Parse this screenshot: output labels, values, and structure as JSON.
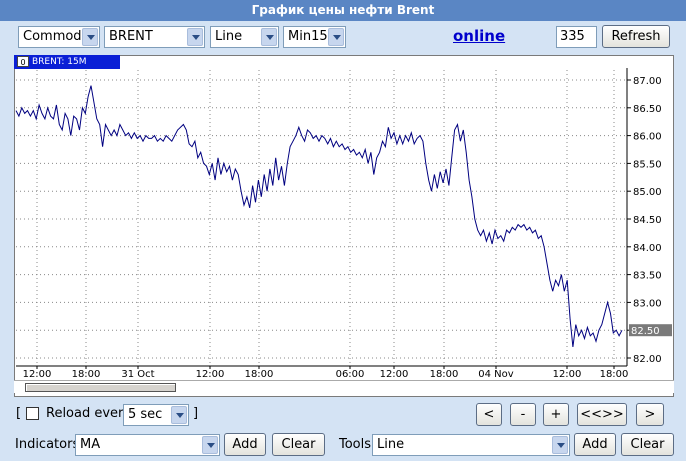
{
  "window": {
    "title": "График цены нефти Brent"
  },
  "toolbar": {
    "market_select": "Commod",
    "symbol_select": "BRENT",
    "type_select": "Line",
    "period_select": "Min15",
    "online_link": "online",
    "count_value": "335",
    "refresh_label": "Refresh"
  },
  "chart": {
    "tab_box": "0",
    "tab_label": "BRENT: 15M",
    "current_price_label": "82.50",
    "line_color": "#000080",
    "highlight_color": "#0a1fd6",
    "y_ticks": [
      "87.00",
      "86.50",
      "86.00",
      "85.50",
      "85.00",
      "84.50",
      "84.00",
      "83.50",
      "83.00",
      "82.50",
      "82.00"
    ],
    "x_ticks": [
      "12:00",
      "18:00",
      "31 Oct",
      "12:00",
      "18:00",
      "06:00",
      "12:00",
      "18:00",
      "04 Nov",
      "12:00",
      "18:00"
    ]
  },
  "chart_data": {
    "type": "line",
    "title": "",
    "xlabel": "",
    "ylabel": "",
    "ylim": [
      81.9,
      87.2
    ],
    "x_ticks": [
      "12:00",
      "18:00",
      "31 Oct",
      "12:00",
      "18:00",
      "06:00",
      "12:00",
      "18:00",
      "04 Nov",
      "12:00",
      "18:00"
    ],
    "y_ticks": [
      87.0,
      86.5,
      86.0,
      85.5,
      85.0,
      84.5,
      84.0,
      83.5,
      83.0,
      82.5,
      82.0
    ],
    "grid": true,
    "current_value": 82.5,
    "series": [
      {
        "values": [
          86.45,
          86.35,
          86.5,
          86.4,
          86.45,
          86.35,
          86.45,
          86.3,
          86.55,
          86.4,
          86.3,
          86.5,
          86.35,
          86.3,
          86.55,
          86.2,
          86.1,
          86.4,
          86.3,
          86.0,
          86.35,
          86.3,
          86.1,
          86.5,
          86.4,
          86.7,
          86.9,
          86.6,
          86.3,
          86.2,
          85.8,
          86.2,
          86.1,
          86.0,
          86.1,
          86.0,
          86.2,
          86.1,
          86.0,
          86.05,
          85.95,
          86.05,
          85.95,
          86.0,
          85.9,
          86.0,
          85.95,
          85.95,
          86.0,
          85.9,
          85.95,
          85.9,
          86.0,
          85.95,
          85.9,
          86.0,
          86.1,
          86.15,
          86.2,
          86.1,
          85.85,
          85.8,
          85.9,
          85.6,
          85.7,
          85.5,
          85.45,
          85.3,
          85.5,
          85.2,
          85.6,
          85.3,
          85.5,
          85.35,
          85.45,
          85.2,
          85.4,
          85.3,
          85.0,
          84.75,
          84.9,
          84.7,
          85.1,
          84.8,
          85.2,
          84.9,
          85.3,
          85.0,
          85.4,
          85.1,
          85.6,
          85.2,
          85.45,
          85.1,
          85.5,
          85.8,
          85.9,
          86.0,
          86.15,
          86.0,
          85.9,
          86.1,
          86.05,
          85.95,
          86.0,
          85.9,
          86.0,
          85.95,
          85.85,
          85.95,
          85.8,
          85.9,
          85.8,
          85.85,
          85.75,
          85.8,
          85.7,
          85.75,
          85.65,
          85.7,
          85.6,
          85.75,
          85.5,
          85.7,
          85.3,
          85.6,
          85.7,
          85.9,
          85.8,
          86.15,
          85.95,
          86.05,
          85.85,
          86.0,
          85.85,
          86.0,
          85.9,
          86.05,
          85.85,
          85.95,
          86.0,
          85.9,
          85.5,
          85.2,
          85.0,
          85.3,
          85.05,
          85.35,
          85.15,
          85.4,
          85.1,
          85.6,
          86.1,
          86.2,
          85.9,
          86.1,
          85.7,
          85.2,
          84.9,
          84.5,
          84.3,
          84.2,
          84.3,
          84.1,
          84.25,
          84.05,
          84.3,
          84.15,
          84.2,
          84.1,
          84.3,
          84.25,
          84.35,
          84.3,
          84.4,
          84.35,
          84.4,
          84.3,
          84.35,
          84.25,
          84.3,
          84.15,
          84.2,
          84.0,
          83.7,
          83.4,
          83.2,
          83.4,
          83.3,
          83.5,
          83.2,
          83.4,
          82.7,
          82.2,
          82.6,
          82.4,
          82.5,
          82.35,
          82.55,
          82.4,
          82.45,
          82.3,
          82.5,
          82.6,
          82.8,
          83.0,
          82.8,
          82.45,
          82.5,
          82.4,
          82.5
        ]
      }
    ]
  },
  "scrollbar": {},
  "controls": {
    "reload_open_bracket": "[",
    "reload_label": "Reload every",
    "reload_interval": "5 sec",
    "reload_close_bracket": "]",
    "nav_back": "<",
    "nav_zoom_out": "-",
    "nav_zoom_in": "+",
    "nav_fit": "<<>>",
    "nav_forward": ">"
  },
  "bottom": {
    "indicators_label": "Indicators",
    "indicators_select": "MA",
    "indicators_add": "Add",
    "indicators_clear": "Clear",
    "tools_label": "Tools",
    "tools_select": "Line",
    "tools_add": "Add",
    "tools_clear": "Clear"
  }
}
